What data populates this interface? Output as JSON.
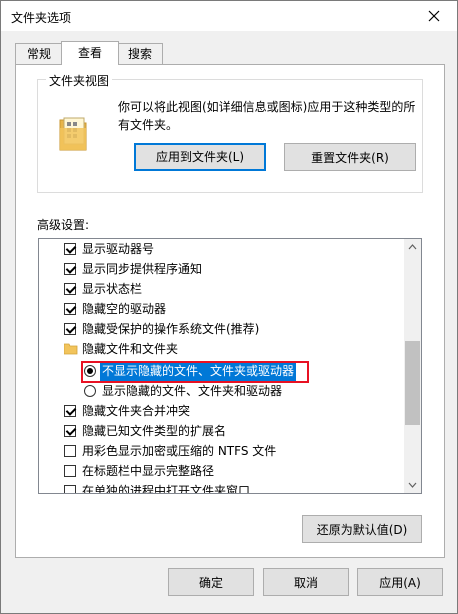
{
  "window": {
    "title": "文件夹选项"
  },
  "tabs": [
    {
      "label": "常规",
      "active": false
    },
    {
      "label": "查看",
      "active": true
    },
    {
      "label": "搜索",
      "active": false
    }
  ],
  "folder_views": {
    "label": "文件夹视图",
    "description": "你可以将此视图(如详细信息或图标)应用于这种类型的所有文件夹。",
    "apply_button": "应用到文件夹(L)",
    "reset_button": "重置文件夹(R)"
  },
  "advanced": {
    "label": "高级设置:",
    "items": [
      {
        "type": "checkbox",
        "checked": true,
        "label": "显示驱动器号"
      },
      {
        "type": "checkbox",
        "checked": true,
        "label": "显示同步提供程序通知"
      },
      {
        "type": "checkbox",
        "checked": true,
        "label": "显示状态栏"
      },
      {
        "type": "checkbox",
        "checked": true,
        "label": "隐藏空的驱动器"
      },
      {
        "type": "checkbox",
        "checked": true,
        "label": "隐藏受保护的操作系统文件(推荐)"
      },
      {
        "type": "folder",
        "label": "隐藏文件和文件夹"
      },
      {
        "type": "radio",
        "checked": true,
        "selected": true,
        "label": "不显示隐藏的文件、文件夹或驱动器"
      },
      {
        "type": "radio",
        "checked": false,
        "label": "显示隐藏的文件、文件夹和驱动器"
      },
      {
        "type": "checkbox",
        "checked": true,
        "label": "隐藏文件夹合并冲突"
      },
      {
        "type": "checkbox",
        "checked": true,
        "label": "隐藏已知文件类型的扩展名"
      },
      {
        "type": "checkbox",
        "checked": false,
        "label": "用彩色显示加密或压缩的 NTFS 文件"
      },
      {
        "type": "checkbox",
        "checked": false,
        "label": "在标题栏中显示完整路径"
      },
      {
        "type": "checkbox",
        "checked": false,
        "label": "在单独的进程中打开文件夹窗口"
      }
    ]
  },
  "restore_defaults_button": "还原为默认值(D)",
  "footer": {
    "ok": "确定",
    "cancel": "取消",
    "apply": "应用(A)"
  },
  "colors": {
    "accent": "#0078d7",
    "highlight_border": "#e81123"
  }
}
